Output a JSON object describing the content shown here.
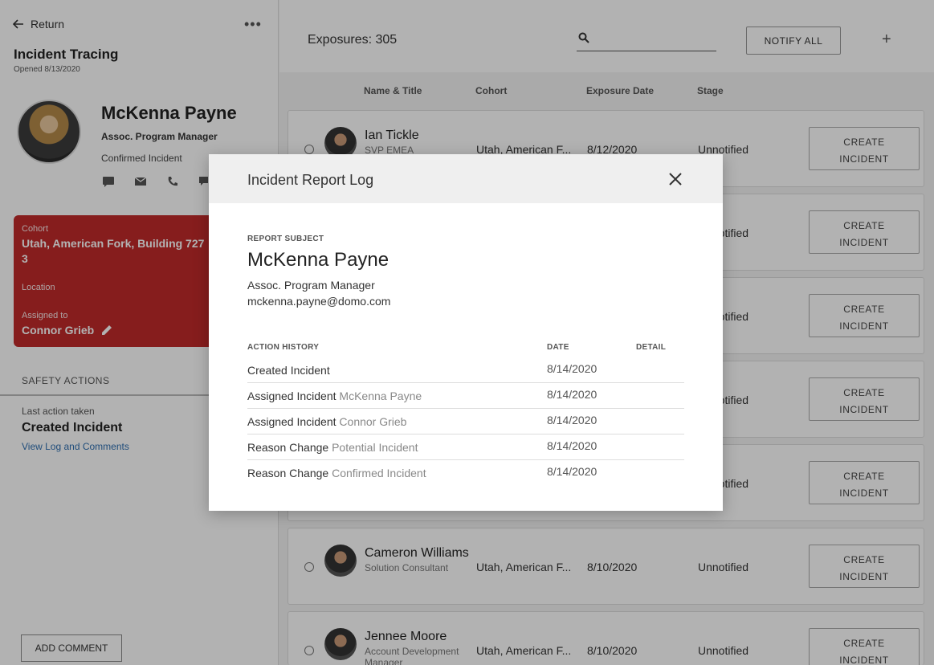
{
  "left": {
    "return_label": "Return",
    "title": "Incident Tracing",
    "opened": "Opened 8/13/2020",
    "person": {
      "name": "McKenna Payne",
      "title": "Assoc. Program Manager",
      "status": "Confirmed Incident"
    },
    "card": {
      "cohort_label": "Cohort",
      "cohort_value": "Utah, American Fork, Building 727",
      "cohort_value_2": "3",
      "location_label": "Location",
      "assigned_label": "Assigned to",
      "assigned_value": "Connor Grieb"
    },
    "safety_actions": "SAFETY ACTIONS",
    "last_action_label": "Last action taken",
    "last_action_value": "Created Incident",
    "view_log": "View Log and Comments",
    "add_comment": "ADD COMMENT"
  },
  "topbar": {
    "exposures": "Exposures: 305",
    "notify_all": "NOTIFY ALL",
    "search_placeholder": ""
  },
  "columns": {
    "name": "Name & Title",
    "cohort": "Cohort",
    "date": "Exposure Date",
    "stage": "Stage"
  },
  "rows": [
    {
      "name": "Ian Tickle",
      "title": "SVP EMEA",
      "cohort": "Utah, American F...",
      "date": "8/12/2020",
      "stage": "Unnotified"
    },
    {
      "stage": "Unnotified"
    },
    {
      "stage": "Unnotified"
    },
    {
      "stage": "Unnotified"
    },
    {
      "stage": "Unnotified"
    },
    {
      "name": "Cameron Williams",
      "title": "Solution Consultant",
      "cohort": "Utah, American F...",
      "date": "8/10/2020",
      "stage": "Unnotified"
    },
    {
      "name": "Jennee Moore",
      "title": "Account Development Manager",
      "cohort": "Utah, American F...",
      "date": "8/10/2020",
      "stage": "Unnotified"
    }
  ],
  "create_line1": "CREATE",
  "create_line2": "INCIDENT",
  "modal": {
    "title": "Incident Report Log",
    "subject_label": "REPORT SUBJECT",
    "subject_name": "McKenna Payne",
    "subject_title": "Assoc. Program Manager",
    "subject_email": "mckenna.payne@domo.com",
    "history_label": "ACTION HISTORY",
    "date_label": "DATE",
    "detail_label": "DETAIL",
    "history": [
      {
        "action": "Created Incident",
        "object": "",
        "date": "8/14/2020"
      },
      {
        "action": "Assigned Incident",
        "object": "McKenna Payne",
        "date": "8/14/2020"
      },
      {
        "action": "Assigned Incident",
        "object": "Connor Grieb",
        "date": "8/14/2020"
      },
      {
        "action": "Reason Change",
        "object": "Potential Incident",
        "date": "8/14/2020"
      },
      {
        "action": "Reason Change",
        "object": "Confirmed Incident",
        "date": "8/14/2020"
      }
    ]
  }
}
